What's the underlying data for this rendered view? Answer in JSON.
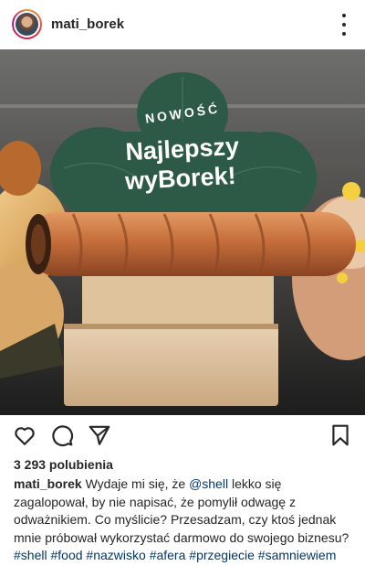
{
  "header": {
    "username": "mati_borek"
  },
  "photo": {
    "sign_top": "NOWOŚĆ",
    "sign_line1": "Najlepszy",
    "sign_line2": "wyBorek!"
  },
  "actions": {
    "like_icon": "heart-icon",
    "comment_icon": "comment-icon",
    "share_icon": "paper-plane-icon",
    "save_icon": "bookmark-icon"
  },
  "likes": {
    "text": "3 293 polubienia"
  },
  "caption": {
    "username": "mati_borek",
    "text1": " Wydaje mi się, że ",
    "mention": "@shell",
    "text2": " lekko się zagalopował, by nie napisać, że pomylił odwagę z odważnikiem. Co myślicie? Przesadzam, czy ktoś jednak mnie próbował wykorzystać darmowo do swojego biznesu? ",
    "hashtags": [
      "#shell",
      "#food",
      "#nazwisko",
      "#afera",
      "#przegiecie",
      "#samniewiem"
    ]
  },
  "colors": {
    "sign_green": "#2d5a46",
    "link_blue": "#00376b"
  }
}
